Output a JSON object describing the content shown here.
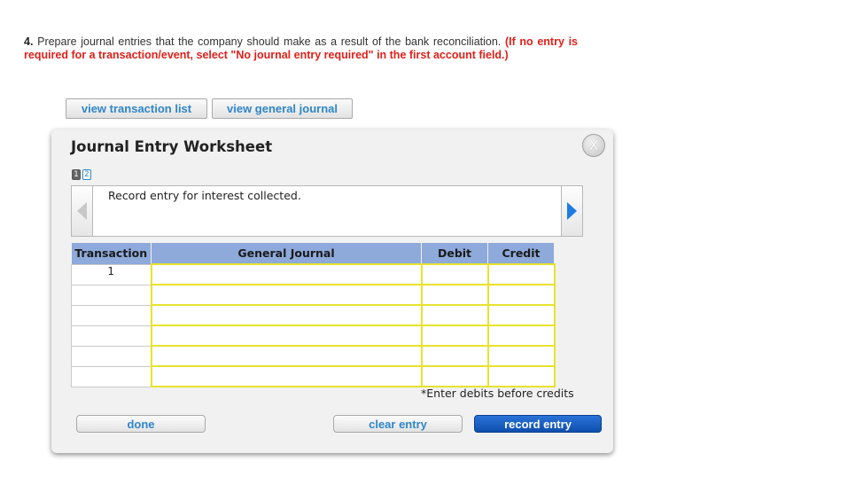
{
  "question": {
    "number": "4.",
    "text": "Prepare journal entries that the company should make as a result of the bank reconciliation.",
    "instruction": "(If no entry is required for a transaction/event, select \"No journal entry required\" in the first account field.)"
  },
  "toolbar": {
    "view_transaction_list": "view transaction list",
    "view_general_journal": "view general journal"
  },
  "worksheet": {
    "title": "Journal Entry Worksheet",
    "close_label": "X",
    "pages": [
      "1",
      "2"
    ],
    "active_page": "1",
    "prompt": "Record entry for interest collected.",
    "columns": {
      "transaction": "Transaction",
      "general_journal": "General Journal",
      "debit": "Debit",
      "credit": "Credit"
    },
    "rows": [
      {
        "transaction": "1",
        "account": "",
        "debit": "",
        "credit": ""
      },
      {
        "transaction": "",
        "account": "",
        "debit": "",
        "credit": ""
      },
      {
        "transaction": "",
        "account": "",
        "debit": "",
        "credit": ""
      },
      {
        "transaction": "",
        "account": "",
        "debit": "",
        "credit": ""
      },
      {
        "transaction": "",
        "account": "",
        "debit": "",
        "credit": ""
      },
      {
        "transaction": "",
        "account": "",
        "debit": "",
        "credit": ""
      }
    ],
    "note": "*Enter debits before credits",
    "buttons": {
      "done": "done",
      "clear_entry": "clear entry",
      "record_entry": "record entry"
    }
  },
  "colors": {
    "header_blue": "#8eaadb",
    "input_border_yellow": "#e8e22e",
    "instruction_red": "#e0201a",
    "link_blue": "#2f86c9",
    "primary_button": "#1560c4"
  }
}
